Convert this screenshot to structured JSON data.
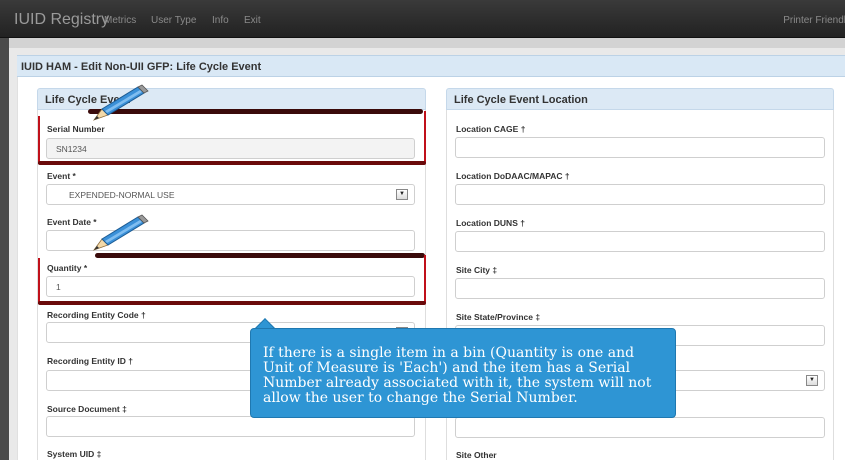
{
  "navbar": {
    "brand": "IUID Registry",
    "items": [
      "Metrics",
      "User Type",
      "Info",
      "Exit"
    ],
    "printer": "Printer Friendly"
  },
  "page": {
    "title": "IUID HAM - Edit Non-UII GFP: Life Cycle Event"
  },
  "left_panel": {
    "title": "Life Cycle Event",
    "fields": {
      "serial_number": {
        "label": "Serial Number",
        "value": "SN1234"
      },
      "event": {
        "label": "Event *",
        "value": "EXPENDED-NORMAL USE"
      },
      "event_date": {
        "label": "Event Date *",
        "value": ""
      },
      "quantity": {
        "label": "Quantity *",
        "value": "1"
      },
      "recording_entity_code": {
        "label": "Recording Entity Code †",
        "value": ""
      },
      "recording_entity_id": {
        "label": "Recording Entity ID †",
        "value": ""
      },
      "source_document": {
        "label": "Source Document ‡",
        "value": ""
      },
      "system_uid": {
        "label": "System UID ‡"
      }
    }
  },
  "right_panel": {
    "title": "Life Cycle Event Location",
    "fields": {
      "location_cage": {
        "label": "Location CAGE †",
        "value": ""
      },
      "location_dodaac": {
        "label": "Location DoDAAC/MAPAC †",
        "value": ""
      },
      "location_duns": {
        "label": "Location DUNS †",
        "value": ""
      },
      "site_city": {
        "label": "Site City ‡",
        "value": ""
      },
      "site_state": {
        "label": "Site State/Province ‡",
        "value": ""
      },
      "site_country": {
        "value": ""
      },
      "site_field_7": {
        "value": ""
      },
      "site_other": {
        "label": "Site Other"
      }
    }
  },
  "callout": {
    "text": "If there is a single item in a bin (Quantity is one and Unit of Measure is 'Each') and the item has a Serial Number already associated with it, the system will not allow the user to change the Serial Number."
  },
  "colors": {
    "highlight": "#c0101a",
    "callout": "#2e95d4",
    "panel_header": "#dce9f5",
    "navbar": "#2a2a2a"
  },
  "icons": {
    "pencil": "pencil-icon",
    "dropdown": "chevron-down-icon"
  }
}
